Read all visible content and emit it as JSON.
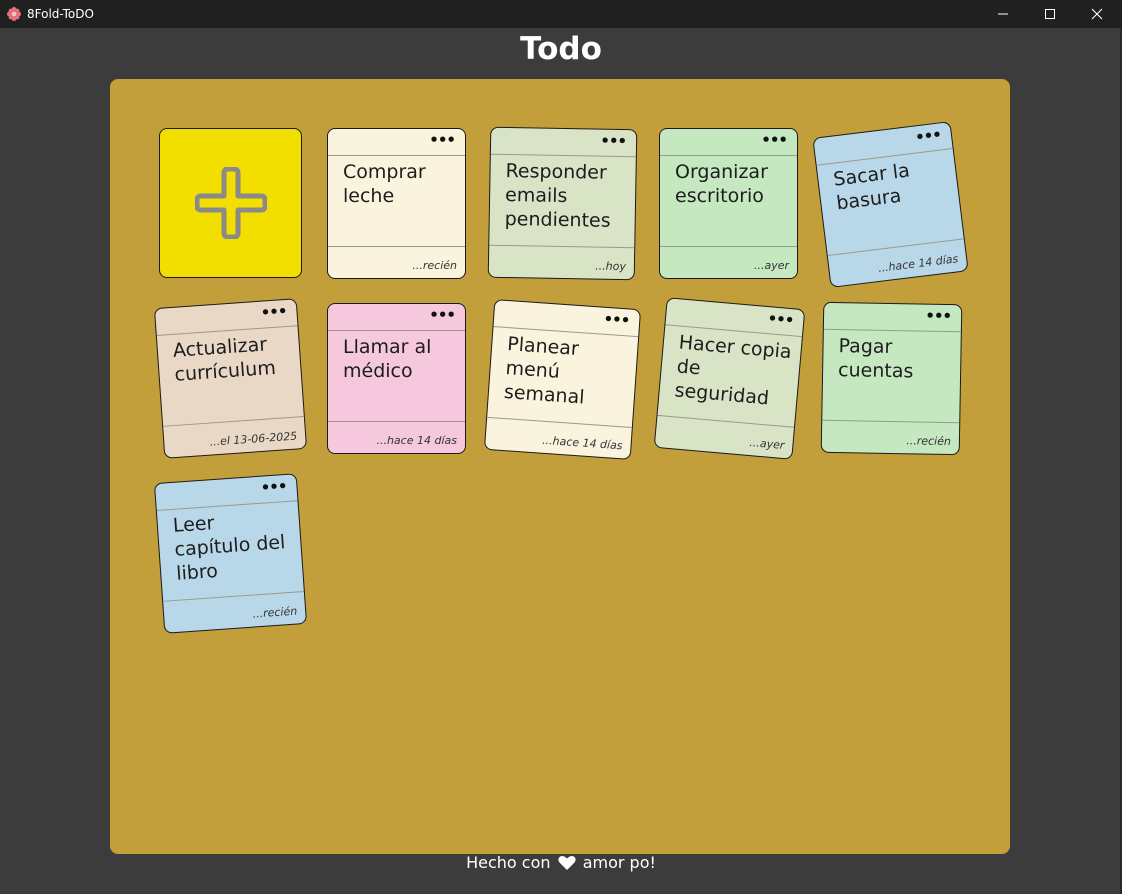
{
  "window": {
    "title": "8Fold-ToDO"
  },
  "page": {
    "title": "Todo"
  },
  "notes": [
    {
      "text": "Comprar leche",
      "time": "...recién",
      "color": "#faf3dd"
    },
    {
      "text": "Responder emails pendientes",
      "time": "...hoy",
      "color": "#d9e3c6"
    },
    {
      "text": "Organizar escritorio",
      "time": "...ayer",
      "color": "#c5e8c1"
    },
    {
      "text": "Sacar la basura",
      "time": "...hace 14 días",
      "color": "#b8d8ea"
    },
    {
      "text": "Actualizar currículum",
      "time": "...el 13-06-2025",
      "color": "#ead8c6"
    },
    {
      "text": "Llamar al médico",
      "time": "...hace 14 días",
      "color": "#f6c8dd"
    },
    {
      "text": "Planear menú semanal",
      "time": "...hace 14 días",
      "color": "#faf3dd"
    },
    {
      "text": "Hacer copia de seguridad",
      "time": "...ayer",
      "color": "#d9e3c6"
    },
    {
      "text": "Pagar cuentas",
      "time": "...recién",
      "color": "#c5e8c1"
    },
    {
      "text": "Leer capítulo del libro",
      "time": "...recién",
      "color": "#b8d8ea"
    }
  ],
  "note_menu_label": "•••",
  "footer": {
    "before": "Hecho con",
    "after": "amor po!"
  },
  "colors": {
    "board": "#c29f3a",
    "add_card": "#f2df00",
    "background": "#3c3c3c"
  },
  "icons": {
    "add": "plus-icon",
    "heart": "heart-icon",
    "app": "flower-icon"
  }
}
